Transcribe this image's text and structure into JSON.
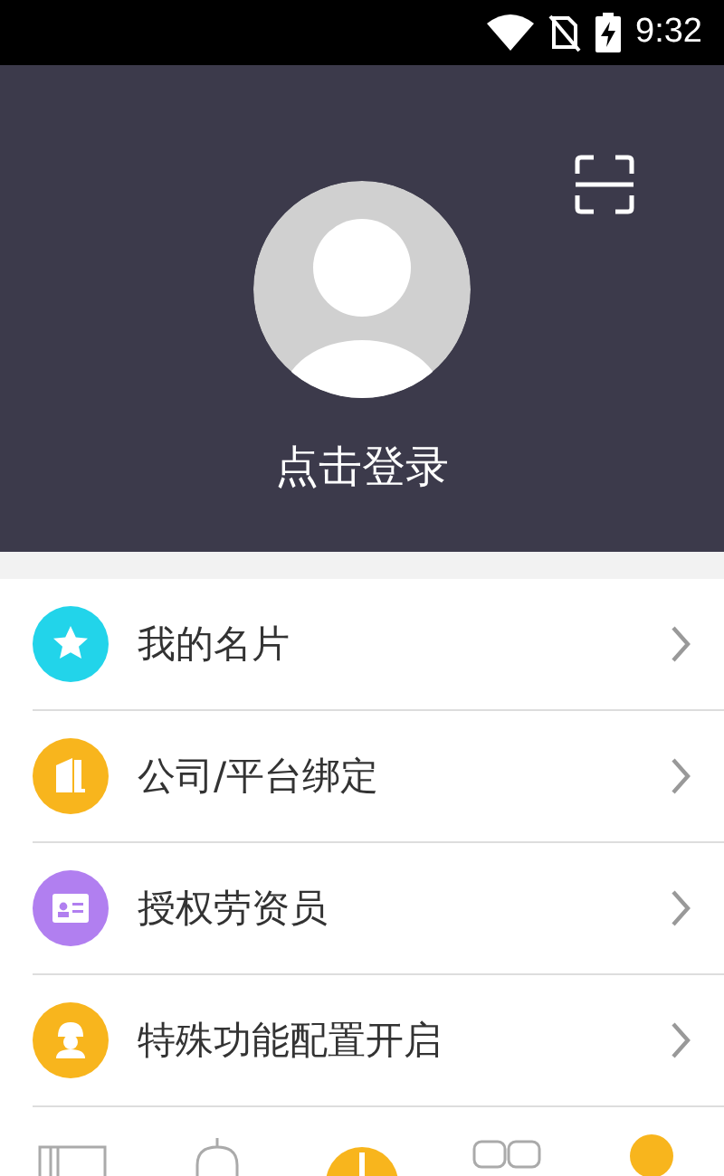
{
  "status_bar": {
    "time": "9:32"
  },
  "profile": {
    "login_label": "点击登录"
  },
  "menu": [
    {
      "label": "我的名片",
      "kind": "star",
      "color": "#22d4ea"
    },
    {
      "label": "公司/平台绑定",
      "kind": "building",
      "color": "#f8b51d"
    },
    {
      "label": "授权劳资员",
      "kind": "card",
      "color": "#b17ff0"
    },
    {
      "label": "特殊功能配置开启",
      "kind": "worker",
      "color": "#f8b51d"
    }
  ],
  "bottom_nav": [
    {
      "kind": "panel",
      "selected": false
    },
    {
      "kind": "bell",
      "selected": false
    },
    {
      "kind": "plus"
    },
    {
      "kind": "boxes",
      "selected": false
    },
    {
      "kind": "person",
      "selected": true
    }
  ]
}
